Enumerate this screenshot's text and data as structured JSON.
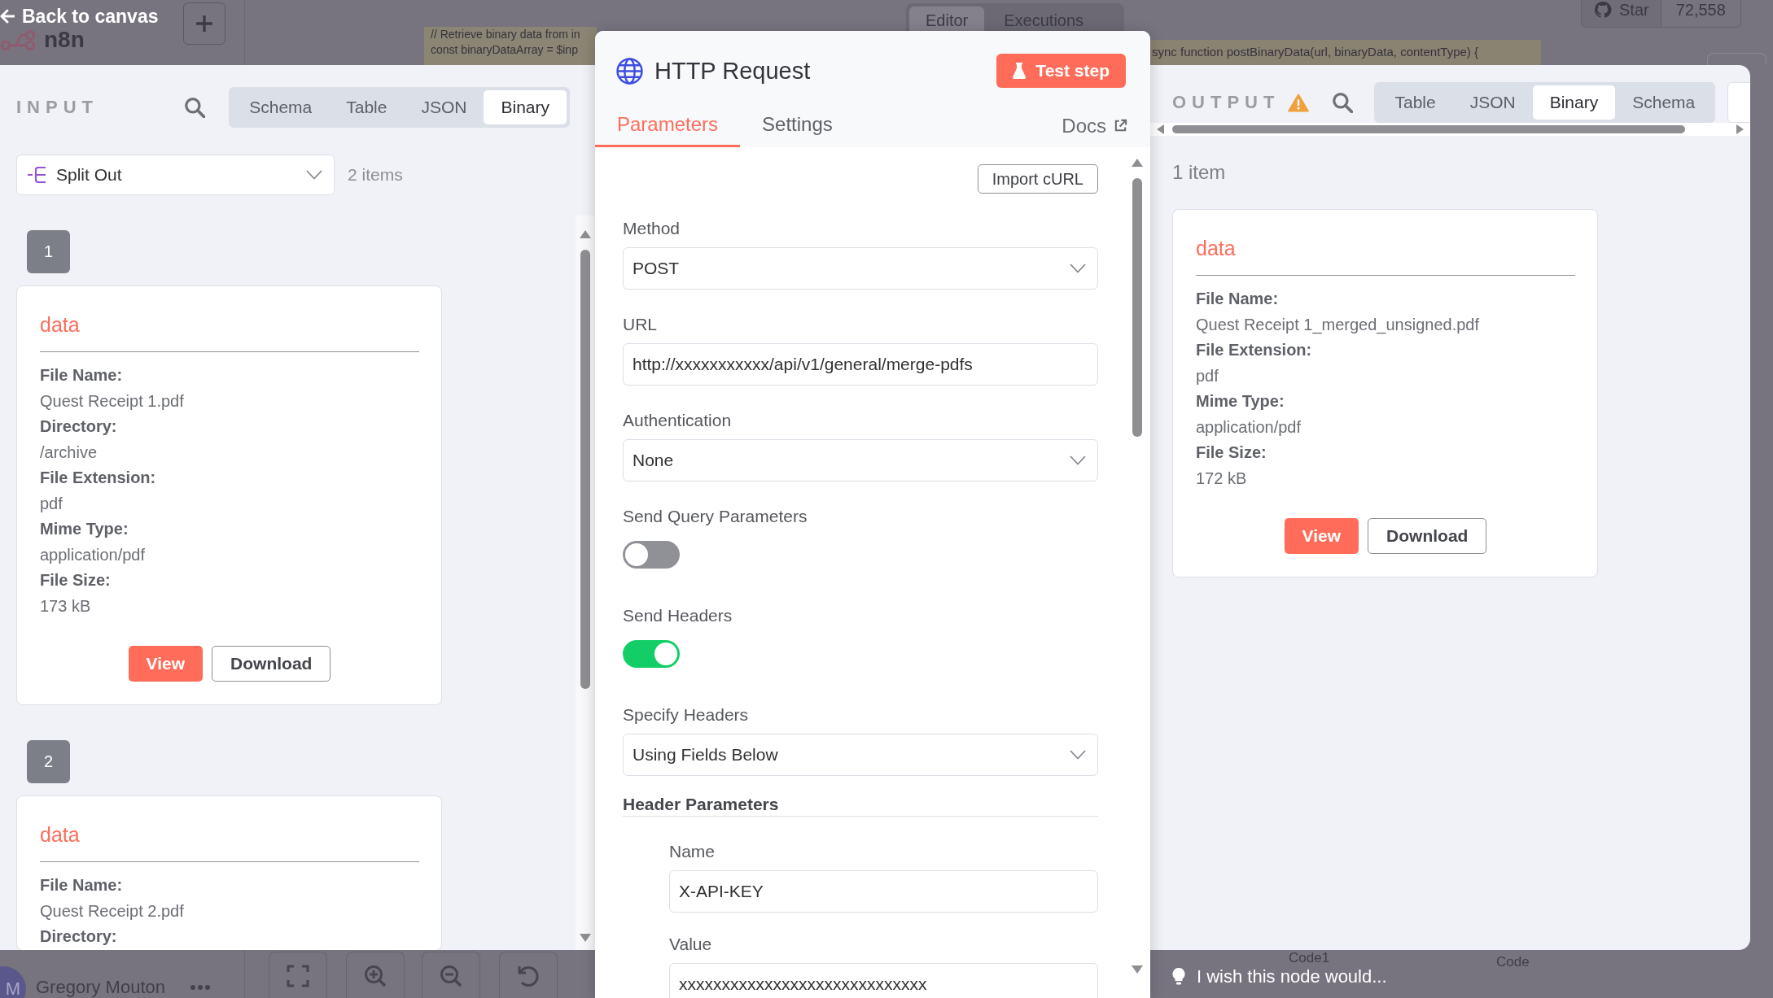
{
  "canvas": {
    "back_link": "Back to canvas",
    "logo_text": "n8n",
    "code_notes": [
      {
        "lines": [
          "// Retrieve binary data from in",
          "const binaryDataArray = $inp"
        ]
      },
      {
        "lines": [
          "sync function postBinaryData(url, binaryData, contentType) {"
        ]
      }
    ],
    "view_tabs": [
      {
        "label": "Editor",
        "selected": true
      },
      {
        "label": "Executions",
        "selected": false
      }
    ],
    "star": {
      "label": "Star",
      "count": "72,558"
    },
    "user": {
      "initials": "M",
      "name": "Gregory Mouton"
    },
    "node_labels": [
      "Code1",
      "Code"
    ]
  },
  "input": {
    "title": "INPUT",
    "tabs": [
      {
        "label": "Schema",
        "selected": false
      },
      {
        "label": "Table",
        "selected": false
      },
      {
        "label": "JSON",
        "selected": false
      },
      {
        "label": "Binary",
        "selected": true
      }
    ],
    "source_node": "Split Out",
    "count": "2 items",
    "items": [
      {
        "index": "1",
        "name": "data",
        "fields": [
          {
            "label": "File Name:",
            "value": "Quest Receipt 1.pdf"
          },
          {
            "label": "Directory:",
            "value": "/archive"
          },
          {
            "label": "File Extension:",
            "value": "pdf"
          },
          {
            "label": "Mime Type:",
            "value": "application/pdf"
          },
          {
            "label": "File Size:",
            "value": "173 kB"
          }
        ],
        "buttons": [
          {
            "label": "View",
            "kind": "primary"
          },
          {
            "label": "Download",
            "kind": "secondary"
          }
        ]
      },
      {
        "index": "2",
        "name": "data",
        "fields": [
          {
            "label": "File Name:",
            "value": "Quest Receipt 2.pdf"
          },
          {
            "label": "Directory:"
          }
        ]
      }
    ]
  },
  "node": {
    "title": "HTTP Request",
    "test_button": "Test step",
    "tabs": [
      {
        "label": "Parameters",
        "selected": true
      },
      {
        "label": "Settings",
        "selected": false
      }
    ],
    "docs": "Docs",
    "import_button": "Import cURL",
    "params": [
      {
        "kind": "select",
        "label": "Method",
        "value": "POST"
      },
      {
        "kind": "text",
        "label": "URL",
        "value": "http://xxxxxxxxxxx/api/v1/general/merge-pdfs"
      },
      {
        "kind": "select",
        "label": "Authentication",
        "value": "None"
      },
      {
        "kind": "toggle",
        "label": "Send Query Parameters",
        "on": false
      },
      {
        "kind": "toggle",
        "label": "Send Headers",
        "on": true
      },
      {
        "kind": "select",
        "label": "Specify Headers",
        "value": "Using Fields Below"
      },
      {
        "kind": "section",
        "label": "Header Parameters",
        "children": [
          {
            "kind": "text",
            "label": "Name",
            "value": "X-API-KEY"
          },
          {
            "kind": "text",
            "label": "Value",
            "value": "xxxxxxxxxxxxxxxxxxxxxxxxxxxxx"
          }
        ]
      }
    ]
  },
  "output": {
    "title": "OUTPUT",
    "warning": true,
    "tabs": [
      {
        "label": "Table",
        "selected": false
      },
      {
        "label": "JSON",
        "selected": false
      },
      {
        "label": "Binary",
        "selected": true
      },
      {
        "label": "Schema",
        "selected": false
      }
    ],
    "count": "1 item",
    "items": [
      {
        "name": "data",
        "fields": [
          {
            "label": "File Name:",
            "value": "Quest Receipt 1_merged_unsigned.pdf"
          },
          {
            "label": "File Extension:",
            "value": "pdf"
          },
          {
            "label": "Mime Type:",
            "value": "application/pdf"
          },
          {
            "label": "File Size:",
            "value": "172 kB"
          }
        ],
        "buttons": [
          {
            "label": "View",
            "kind": "primary"
          },
          {
            "label": "Download",
            "kind": "secondary"
          }
        ]
      }
    ]
  },
  "feedback": "I wish this node would..."
}
